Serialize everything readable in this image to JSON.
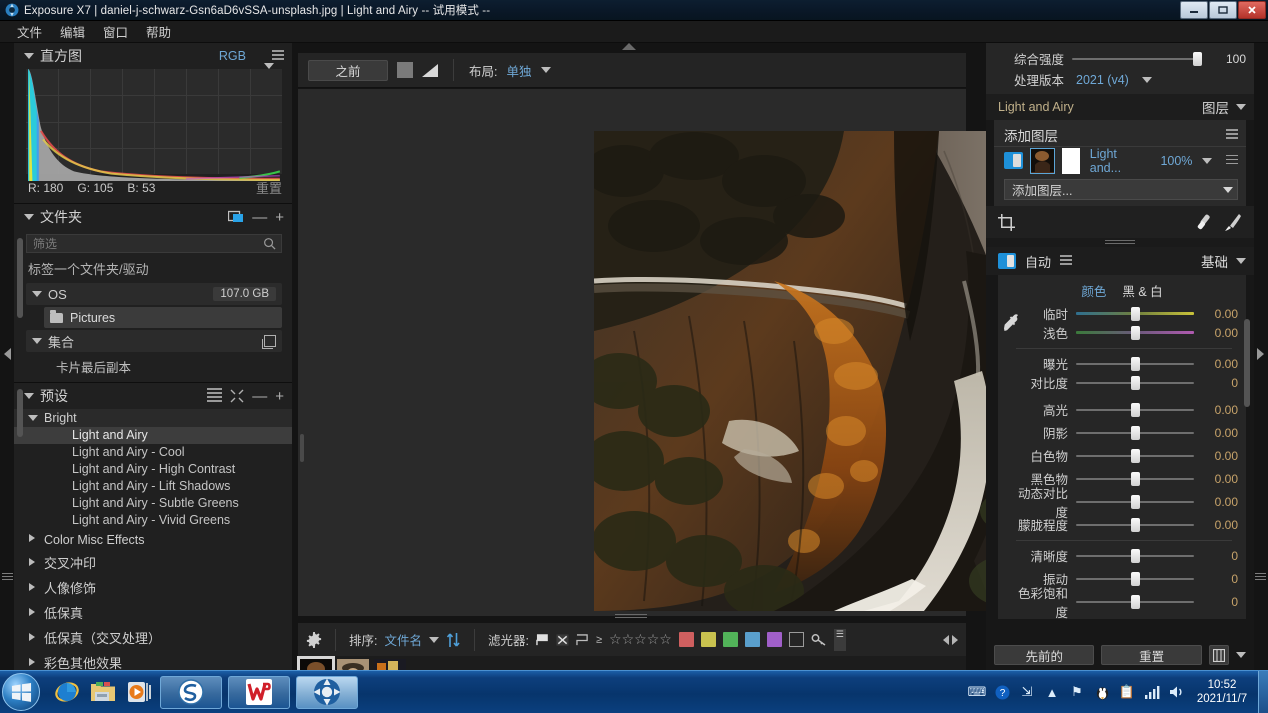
{
  "window": {
    "title": "Exposure X7 | daniel-j-schwarz-Gsn6aD6vSSA-unsplash.jpg | Light and Airy -- 试用模式 --",
    "logo_icon": "exposure-logo-icon",
    "minimize_icon": "minimize-icon",
    "maximize_icon": "maximize-icon",
    "close_icon": "close-icon"
  },
  "menubar": {
    "items": [
      {
        "label": "文件",
        "name": "menu-file"
      },
      {
        "label": "编辑",
        "name": "menu-edit"
      },
      {
        "label": "窗口",
        "name": "menu-window"
      },
      {
        "label": "帮助",
        "name": "menu-help"
      }
    ]
  },
  "left_panel": {
    "histogram": {
      "title": "直方图",
      "channel": "RGB",
      "menu_icon": "hamburger-icon",
      "readout": {
        "r_label": "R: 180",
        "g_label": "G: 105",
        "b_label": "B: 53"
      },
      "reset_label": "重置"
    },
    "folders": {
      "title": "文件夹",
      "add_folder_icon": "add-folder-icon",
      "minus_label": "—",
      "plus_label": "+",
      "filter_placeholder": "筛选",
      "search_icon": "search-icon",
      "tag_label": "标签一个文件夹/驱动",
      "drive": {
        "name": "OS",
        "size": "107.0 GB"
      },
      "subfolder": {
        "name": "Pictures",
        "icon": "folder-icon"
      },
      "collection": {
        "name": "集合",
        "icon": "stack-icon"
      },
      "collection_item": "卡片最后副本"
    },
    "presets": {
      "title": "预设",
      "list_icon": "list-view-icon",
      "collapse_icon": "collapse-all-icon",
      "minus_label": "—",
      "plus_label": "+",
      "groups": [
        {
          "label": "Bright",
          "expanded": true,
          "selected_child": "Light and Airy",
          "items": [
            "Light and Airy",
            "Light and Airy - Cool",
            "Light and Airy - High Contrast",
            "Light and Airy - Lift Shadows",
            "Light and Airy - Subtle Greens",
            "Light and Airy - Vivid Greens"
          ]
        },
        {
          "label": "Color Misc Effects",
          "expanded": false,
          "items": []
        },
        {
          "label": "交叉冲印",
          "expanded": false,
          "items": []
        },
        {
          "label": "人像修饰",
          "expanded": false,
          "items": []
        },
        {
          "label": "低保真",
          "expanded": false,
          "items": []
        },
        {
          "label": "低保真（交叉处理）",
          "expanded": false,
          "items": []
        },
        {
          "label": "彩色其他效果",
          "expanded": false,
          "items": []
        }
      ]
    }
  },
  "center": {
    "toolbar": {
      "before_label": "之前",
      "square_icon": "square-view-icon",
      "gradient_icon": "gradient-view-icon",
      "layout_label": "布局:",
      "layout_value": "单独",
      "layout_caret_icon": "chevron-down-icon"
    },
    "image": {
      "alt_name": "canyon-river-landscape-photo"
    },
    "filmstrip_toolbar": {
      "gear_icon": "gear-icon",
      "sort_label": "排序:",
      "sort_value": "文件名",
      "sort_caret_icon": "chevron-down-icon",
      "sort_direction_icon": "sort-direction-icon",
      "filter_label": "滤光器:",
      "flag_pick_icon": "flag-pick-icon",
      "flag_reject_icon": "flag-reject-icon",
      "flag_unflagged_icon": "flag-unflagged-icon",
      "rating_prefix": "≥",
      "star_count": 5,
      "star_icon": "star-outline-icon",
      "color_swatches": [
        "#cf5f5f",
        "#c9c24f",
        "#52b359",
        "#5a9fcc",
        "#a05fc9"
      ],
      "no_color_icon": "no-color-icon",
      "keyword_icon": "key-icon",
      "more_icon": "more-filters-icon",
      "prev_icon": "chevron-left-icon",
      "next_icon": "chevron-right-icon"
    },
    "thumbnails": [
      {
        "name": "thumb-1",
        "selected": true
      },
      {
        "name": "thumb-2",
        "selected": false
      },
      {
        "name": "thumb-3",
        "selected": false
      }
    ]
  },
  "right_panel": {
    "top": {
      "strength_label": "综合强度",
      "strength_value": "100",
      "process_label": "处理版本",
      "process_value": "2021 (v4)",
      "process_caret_icon": "chevron-down-icon"
    },
    "layers_header": {
      "preset_name": "Light and Airy",
      "section_label": "图层",
      "caret_icon": "chevron-down-icon"
    },
    "layers": {
      "add_label": "添加图层",
      "menu_icon": "hamburger-icon",
      "row": {
        "visibility_icon": "visibility-toggle-icon",
        "layer_thumb_icon": "layer-thumbnail",
        "mask_thumb_icon": "mask-thumbnail",
        "name": "Light and...",
        "opacity": "100%",
        "caret_icon": "chevron-down-icon",
        "row_menu_icon": "hamburger-icon"
      },
      "add_select_value": "添加图层...",
      "add_select_caret_icon": "chevron-down-icon",
      "add_select_menu_icon": "list-menu-icon"
    },
    "tools": {
      "crop_icon": "crop-icon",
      "heal_icon": "heal-brush-icon",
      "brush_icon": "brush-icon"
    },
    "adjustments": {
      "toggle_icon": "adjustment-toggle-icon",
      "auto_label": "自动",
      "auto_menu_icon": "hamburger-icon",
      "section_label": "基础",
      "section_caret_icon": "chevron-down-icon",
      "tabs": {
        "color": "颜色",
        "bw": "黑 & 白",
        "active": "颜色"
      },
      "eyedropper_icon": "eyedropper-icon",
      "groups": [
        {
          "name": "white-balance",
          "sliders": [
            {
              "label": "临时",
              "value": "0.00",
              "pos": 50,
              "track": "temp"
            },
            {
              "label": "浅色",
              "value": "0.00",
              "pos": 50,
              "track": "tint"
            }
          ]
        },
        {
          "name": "tone",
          "sliders": [
            {
              "label": "曝光",
              "value": "0.00",
              "pos": 50,
              "track": "plain"
            },
            {
              "label": "对比度",
              "value": "0",
              "pos": 50,
              "track": "plain"
            }
          ]
        },
        {
          "name": "tone2",
          "sliders": [
            {
              "label": "高光",
              "value": "0.00",
              "pos": 50,
              "track": "plain"
            },
            {
              "label": "阴影",
              "value": "0.00",
              "pos": 50,
              "track": "plain"
            },
            {
              "label": "白色物",
              "value": "0.00",
              "pos": 50,
              "track": "plain"
            },
            {
              "label": "黑色物",
              "value": "0.00",
              "pos": 50,
              "track": "plain"
            },
            {
              "label": "动态对比度",
              "value": "0.00",
              "pos": 50,
              "track": "plain"
            },
            {
              "label": "朦胧程度",
              "value": "0.00",
              "pos": 50,
              "track": "plain"
            }
          ]
        },
        {
          "name": "presence",
          "sliders": [
            {
              "label": "清晰度",
              "value": "0",
              "pos": 50,
              "track": "plain"
            },
            {
              "label": "振动",
              "value": "0",
              "pos": 50,
              "track": "plain"
            },
            {
              "label": "色彩饱和度",
              "value": "0",
              "pos": 50,
              "track": "plain"
            }
          ]
        }
      ]
    },
    "footer": {
      "previous_label": "先前的",
      "reset_label": "重置",
      "copy_icon": "copy-settings-icon",
      "copy_caret_icon": "chevron-down-icon"
    }
  },
  "taskbar": {
    "start_icon": "windows-start-icon",
    "quick_launch": [
      {
        "name": "internet-explorer-icon"
      },
      {
        "name": "file-explorer-icon"
      },
      {
        "name": "media-player-icon"
      }
    ],
    "tasks": [
      {
        "name": "sogou-app-icon",
        "active": false
      },
      {
        "name": "wps-app-icon",
        "active": false
      },
      {
        "name": "exposure-app-icon",
        "active": true
      }
    ],
    "tray": [
      {
        "name": "keyboard-tray-icon"
      },
      {
        "name": "help-tray-icon"
      },
      {
        "name": "network-share-tray-icon"
      },
      {
        "name": "show-hidden-tray-icon"
      },
      {
        "name": "flag-tray-icon"
      },
      {
        "name": "qq-tray-icon"
      },
      {
        "name": "clipboard-tray-icon"
      },
      {
        "name": "signal-tray-icon"
      },
      {
        "name": "volume-tray-icon"
      }
    ],
    "clock": {
      "time": "10:52",
      "date": "2021/11/7"
    }
  }
}
